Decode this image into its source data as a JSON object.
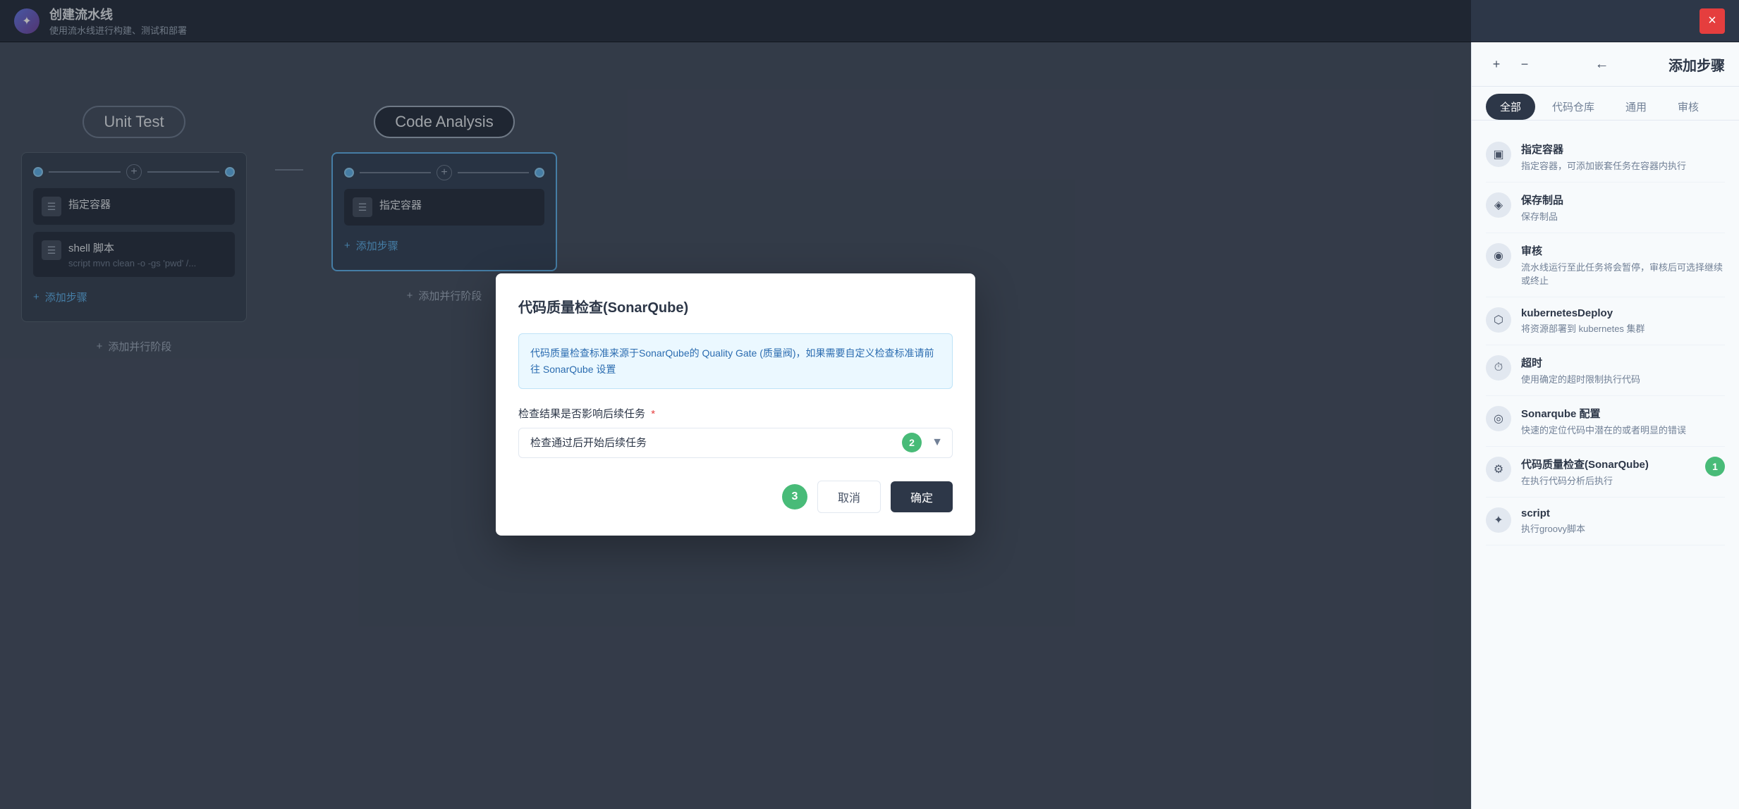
{
  "header": {
    "title": "创建流水线",
    "subtitle": "使用流水线进行构建、测试和部署",
    "close_label": "×"
  },
  "pipeline": {
    "stage1": {
      "label": "Unit Test",
      "step_icon": "☰",
      "step_title": "指定容器",
      "step_name": "shell 脚本",
      "step_desc": "script   mvn clean -o -gs  'pwd' /...",
      "add_step": "添加步骤",
      "add_parallel": "添加并行阶段"
    },
    "stage2": {
      "label": "Code Analysis",
      "step_icon": "☰",
      "step_title": "指定容器",
      "add_step": "添加步骤",
      "add_parallel": "添加并行阶段"
    }
  },
  "right_panel": {
    "title": "添加步骤",
    "tabs": [
      {
        "label": "全部",
        "active": true
      },
      {
        "label": "代码仓库"
      },
      {
        "label": "通用"
      },
      {
        "label": "审核"
      }
    ],
    "items": [
      {
        "name": "指定容器",
        "desc": "指定容器，可添加嵌套任务在容器内执行",
        "badge": null
      },
      {
        "name": "保存制品",
        "desc": "保存制品",
        "badge": null
      },
      {
        "name": "审核",
        "desc": "流水线运行至此任务将会暂停，审核后可选择继续或终止",
        "badge": null
      },
      {
        "name": "kubernetesDeploy",
        "desc": "将资源部署到 kubernetes 集群",
        "badge": null
      },
      {
        "name": "超时",
        "desc": "使用确定的超时限制执行代码",
        "badge": null
      },
      {
        "name": "Sonarqube 配置",
        "desc": "快速的定位代码中潜在的或者明显的错误",
        "badge": null
      },
      {
        "name": "代码质量检查(SonarQube)",
        "desc": "在执行代码分析后执行",
        "badge": "1"
      },
      {
        "name": "script",
        "desc": "执行groovy脚本",
        "badge": null
      }
    ]
  },
  "modal": {
    "title": "代码质量检查(SonarQube)",
    "info_text": "代码质量检查标准来源于SonarQube的 Quality Gate (质量阀)，如果需要自定义检查标准请前往 SonarQube 设置",
    "field_label": "检查结果是否影响后续任务",
    "field_required": true,
    "select_value": "检查通过后开始后续任务",
    "select_badge": "2",
    "cancel_label": "取消",
    "confirm_label": "确定",
    "confirm_badge": "3"
  }
}
